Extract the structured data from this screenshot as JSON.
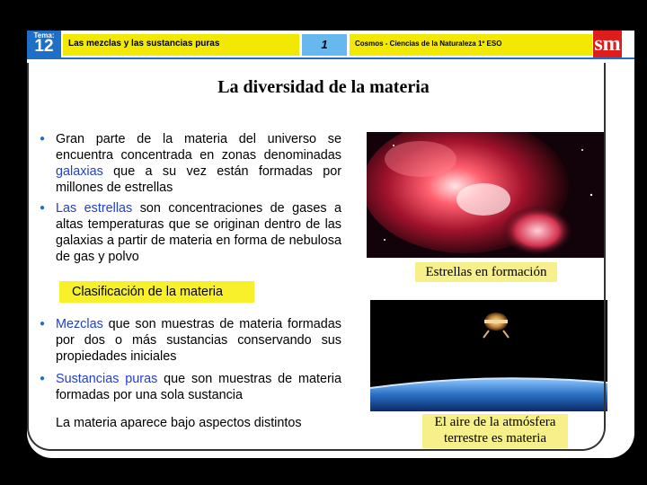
{
  "header": {
    "tema_label": "Tema:",
    "tema_number": "12",
    "title": "Las mezclas y las sustancias puras",
    "page_number": "1",
    "series": "Cosmos - Ciencias de la Naturaleza 1º ESO",
    "logo": "sm"
  },
  "main_title": "La diversidad de la materia",
  "bullets_top": [
    {
      "pre": "Gran parte de la materia del universo se encuentra concentrada en zonas denominadas ",
      "link": "galaxias",
      "post": " que a su vez están formadas por millones de estrellas"
    },
    {
      "pre": "",
      "link": "Las estrellas",
      "post": " son concentraciones de gases a altas temperaturas que se originan dentro de las galaxias a partir de materia en forma de nebulosa de gas y polvo"
    }
  ],
  "classification_label": "Clasificación de la materia",
  "bullets_bottom": [
    {
      "pre": "",
      "link": "Mezclas",
      "post": " que son muestras de materia formadas por dos o más sustancias conservando sus propiedades iniciales"
    },
    {
      "pre": "",
      "link": "Sustancias puras",
      "post": " que son muestras de materia formadas por una sola sustancia"
    }
  ],
  "footer_text": "La materia aparece bajo aspectos distintos",
  "captions": {
    "photo1": "Estrellas en formación",
    "photo2_line1": "El aire de la atmósfera",
    "photo2_line2": "terrestre es materia"
  },
  "colors": {
    "accent_blue": "#1f6fc6",
    "link_blue": "#1f3ed6",
    "header_yellow": "#f2e800",
    "logo_red": "#e01d1d"
  }
}
